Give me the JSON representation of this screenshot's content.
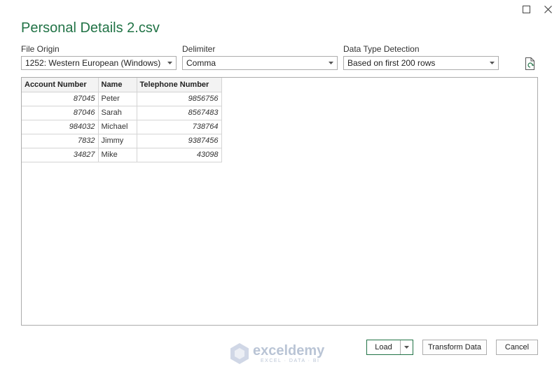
{
  "dialog": {
    "title": "Personal Details 2.csv"
  },
  "fields": {
    "file_origin": {
      "label": "File Origin",
      "value": "1252: Western European (Windows)"
    },
    "delimiter": {
      "label": "Delimiter",
      "value": "Comma"
    },
    "data_type_detection": {
      "label": "Data Type Detection",
      "value": "Based on first 200 rows"
    }
  },
  "icons": {
    "maximize": "maximize-icon",
    "close": "close-icon",
    "refresh": "refresh-file-icon",
    "caret": "chevron-down-icon"
  },
  "table": {
    "headers": [
      "Account Number",
      "Name",
      "Telephone Number"
    ],
    "rows": [
      [
        "87045",
        "Peter",
        "9856756"
      ],
      [
        "87046",
        "Sarah",
        "8567483"
      ],
      [
        "984032",
        "Michael",
        "738764"
      ],
      [
        "7832",
        "Jimmy",
        "9387456"
      ],
      [
        "34827",
        "Mike",
        "43098"
      ]
    ]
  },
  "watermark": {
    "brand": "exceldemy",
    "tagline": "EXCEL · DATA · BI"
  },
  "buttons": {
    "load": "Load",
    "transform": "Transform Data",
    "cancel": "Cancel"
  },
  "colors": {
    "title_green": "#217346",
    "border": "#adadad"
  }
}
